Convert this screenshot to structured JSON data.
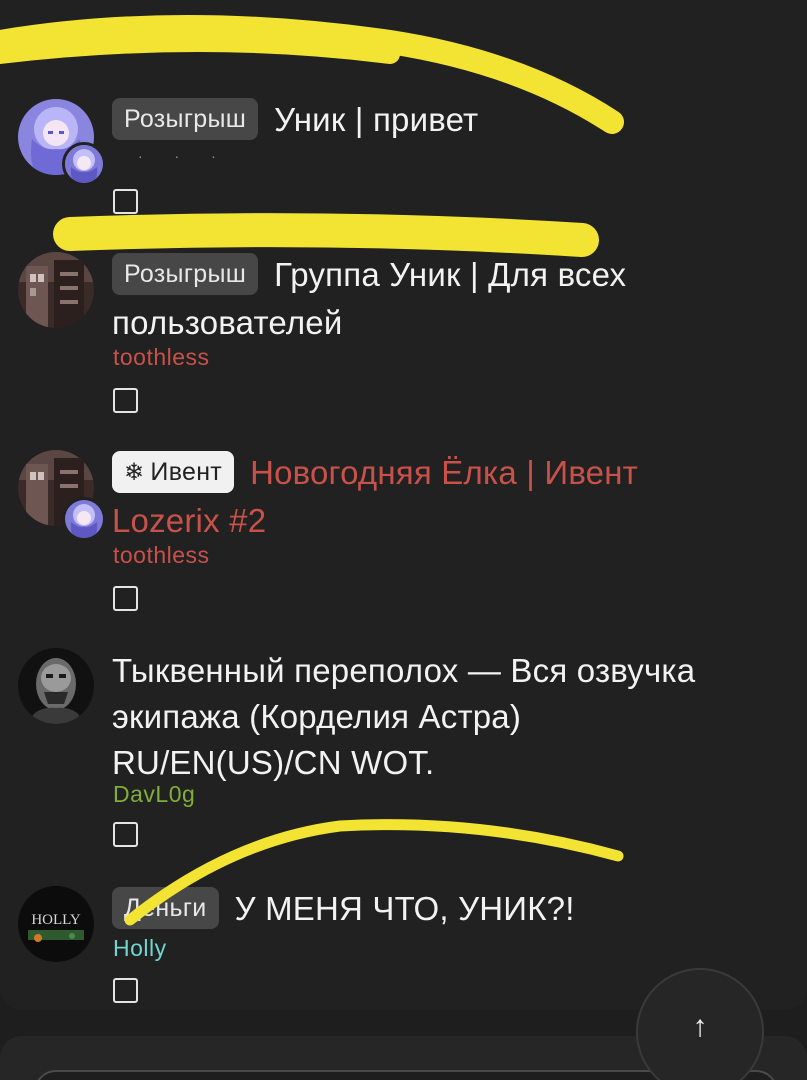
{
  "threads": [
    {
      "tag": "Розыгрыш",
      "title_line1": "Уник | привет",
      "title_line2": "",
      "author": "",
      "author_color": "",
      "avatar": "anime-girl-avatar",
      "mini_avatar": "anime-girl-avatar"
    },
    {
      "tag": "Розыгрыш",
      "title_line1": "Группа Уник | Для всех",
      "title_line2": "пользователей",
      "author": "toothless",
      "author_color": "#c8514a",
      "avatar": "building-avatar"
    },
    {
      "tag": "Ивент",
      "tag_icon": "❄",
      "title_line1": "Новогодняя Ёлка | Ивент",
      "title_line2": "Lozerix #2",
      "title_color": "#c8514a",
      "author": "toothless",
      "author_color": "#c8514a",
      "avatar": "building-avatar",
      "mini_avatar": "anime-girl-avatar"
    },
    {
      "tag": "",
      "title_line1": "Тыквенный переполох — Вся озвучка",
      "title_line2": "экипажа (Корделия Астра)",
      "title_line3": "RU/EN(US)/CN WOT.",
      "author": "DavL0g",
      "author_color": "#7fae3a",
      "avatar": "masked-face-avatar"
    },
    {
      "tag": "Деньги",
      "title_line1": "У МЕНЯ ЧТО, УНИК?!",
      "author": "Holly",
      "author_color": "#6fd6d0",
      "avatar": "holly-logo-avatar",
      "avatar_text": "HOLLY"
    }
  ],
  "scroll_top_button": {
    "icon": "arrow-up-icon",
    "glyph": "↑"
  },
  "colors": {
    "background": "#1e1e1e",
    "card": "#212121",
    "tag": "#474747",
    "marker": "#f3e433"
  }
}
